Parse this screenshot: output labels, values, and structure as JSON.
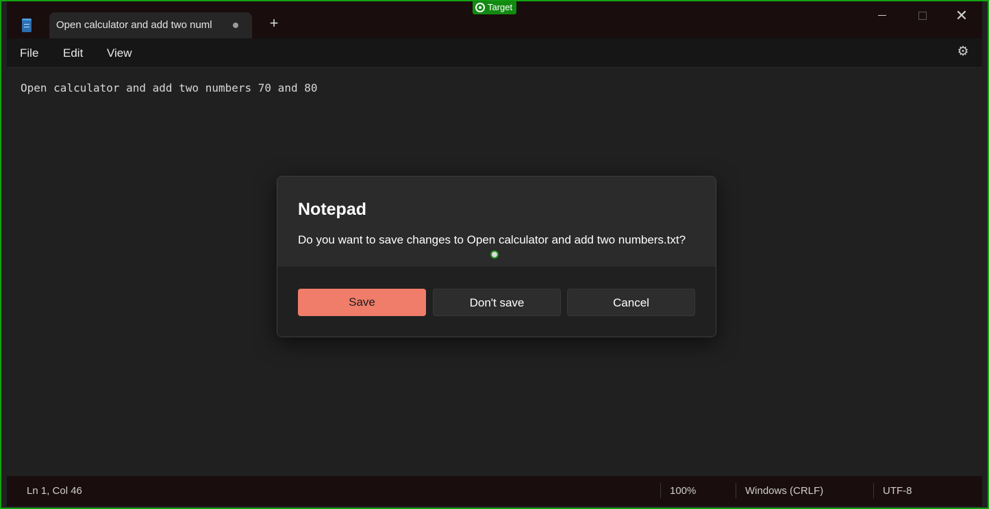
{
  "app": {
    "name": "Notepad",
    "tab_title": "Open calculator and add two numl",
    "new_tab": "+",
    "close_glyph": "✕"
  },
  "overlay": {
    "target_label": "Target"
  },
  "menu": {
    "file": "File",
    "edit": "Edit",
    "view": "View",
    "settings_icon": "gear-icon"
  },
  "editor": {
    "content": "Open calculator and add two numbers 70 and 80"
  },
  "status": {
    "position": "Ln 1, Col 46",
    "zoom": "100%",
    "line_endings": "Windows (CRLF)",
    "encoding": "UTF-8"
  },
  "dialog": {
    "title": "Notepad",
    "message": "Do you want to save changes to Open calculator and add two numbers.txt?",
    "save": "Save",
    "dont_save": "Don't save",
    "cancel": "Cancel"
  },
  "colors": {
    "accent": "#ef7d6a",
    "frame": "#12a312",
    "background": "#202020"
  }
}
